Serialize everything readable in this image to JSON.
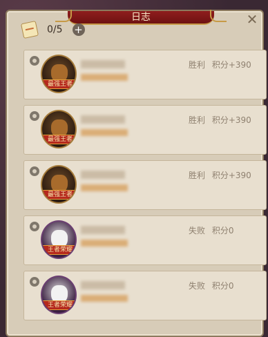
{
  "dialog": {
    "title": "日志"
  },
  "header": {
    "count": "0/5"
  },
  "entries": [
    {
      "result": "胜利",
      "score": "积分+390",
      "avatar": "pharaoh-mask",
      "rank": "最强王者"
    },
    {
      "result": "胜利",
      "score": "积分+390",
      "avatar": "pharaoh-mask",
      "rank": "最强王者"
    },
    {
      "result": "胜利",
      "score": "积分+390",
      "avatar": "pharaoh-mask",
      "rank": "最强王者"
    },
    {
      "result": "失败",
      "score": "积分0",
      "avatar": "masked-warrior",
      "rank": "王者荣耀"
    },
    {
      "result": "失败",
      "score": "积分0",
      "avatar": "masked-warrior",
      "rank": "王者荣耀"
    }
  ],
  "icons": {
    "close": "close-icon",
    "ticket": "ticket-icon",
    "plus": "plus-icon",
    "pin": "pin-icon"
  }
}
